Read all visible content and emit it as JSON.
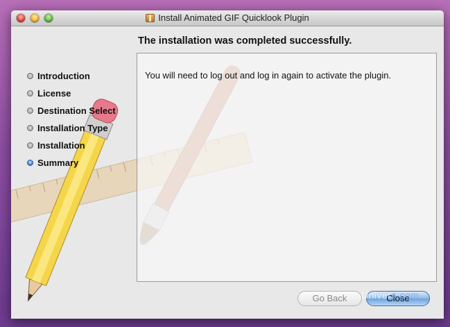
{
  "window": {
    "title": "Install Animated GIF Quicklook Plugin",
    "title_icon": "package-icon"
  },
  "heading": "The installation was completed successfully.",
  "steps": [
    {
      "label": "Introduction",
      "state": "done"
    },
    {
      "label": "License",
      "state": "done"
    },
    {
      "label": "Destination Select",
      "state": "done"
    },
    {
      "label": "Installation Type",
      "state": "done"
    },
    {
      "label": "Installation",
      "state": "done"
    },
    {
      "label": "Summary",
      "state": "current"
    }
  ],
  "message": "You will need to log out and log in again to activate the plugin.",
  "buttons": {
    "back": "Go Back",
    "close": "Close",
    "back_enabled": false,
    "close_default": true
  },
  "watermark": {
    "left": "Univer",
    "right": "s.com"
  },
  "colors": {
    "desktop": "#8e4fa3",
    "window_bg": "#e8e8e8",
    "current_step": "#3a78d8",
    "default_button": "#6ea3df"
  }
}
